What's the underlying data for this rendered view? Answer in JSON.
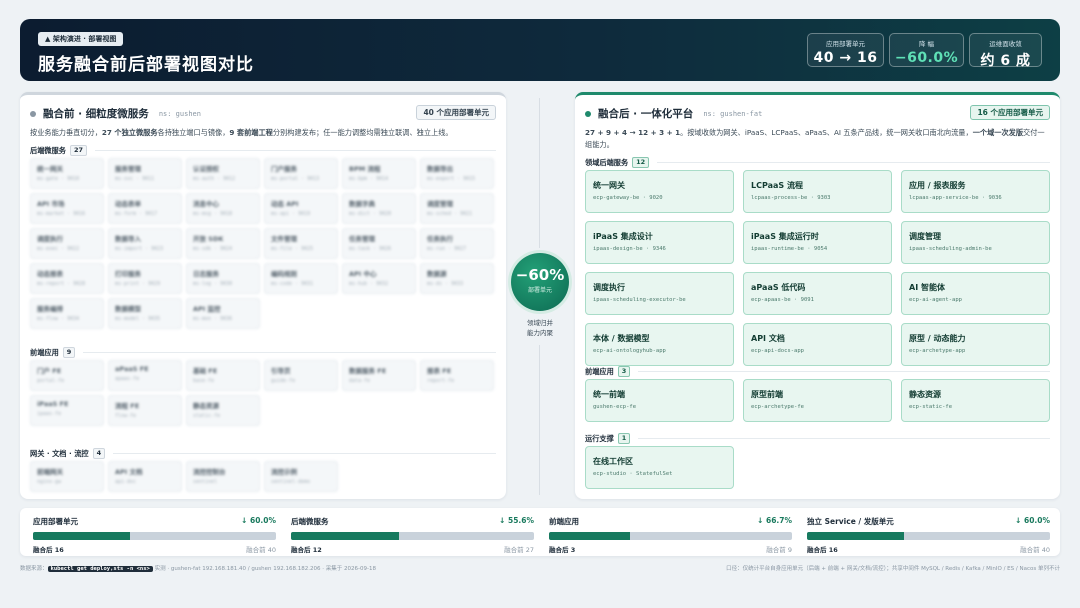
{
  "header": {
    "tag": "▲ 架构演进 · 部署视图",
    "title": "服务融合前后部署视图对比",
    "kpis": [
      {
        "label": "应用部署单元",
        "value": "40 → 16"
      },
      {
        "label": "降 幅",
        "value": "−60.0%"
      },
      {
        "label": "运维面收敛",
        "value": "约 6 成"
      }
    ]
  },
  "left": {
    "title": "融合前 · 细粒度微服务",
    "ns": "ns: gushen",
    "badge": "40 个应用部署单元",
    "desc": {
      "a": "按业务能力垂直切分，",
      "b": "27 个独立微服务",
      "c": "各持独立端口与镜像，",
      "d": "9 套前端工程",
      "e": "分别构建发布；任一能力调整均需独立联调、独立上线。"
    },
    "sections": [
      {
        "label": "后端微服务",
        "count": "27",
        "items": [
          {
            "n": "统一网关",
            "c": "ms-gate · 9010"
          },
          {
            "n": "服务管理",
            "c": "ms-svc · 9011"
          },
          {
            "n": "认证授权",
            "c": "ms-auth · 9012"
          },
          {
            "n": "门户服务",
            "c": "ms-portal · 9013"
          },
          {
            "n": "BPM 流程",
            "c": "ms-bpm · 9014"
          },
          {
            "n": "数据导出",
            "c": "ms-export · 9015"
          },
          {
            "n": "API 市场",
            "c": "ms-market · 9016"
          },
          {
            "n": "动态表单",
            "c": "ms-form · 9017"
          },
          {
            "n": "消息中心",
            "c": "ms-msg · 9018"
          },
          {
            "n": "动态 API",
            "c": "ms-api · 9019"
          },
          {
            "n": "数据字典",
            "c": "ms-dict · 9020"
          },
          {
            "n": "调度管理",
            "c": "ms-sched · 9021"
          },
          {
            "n": "调度执行",
            "c": "ms-exec · 9022"
          },
          {
            "n": "数据导入",
            "c": "ms-import · 9023"
          },
          {
            "n": "开放 SDK",
            "c": "ms-sdk · 9024"
          },
          {
            "n": "文件管理",
            "c": "ms-file · 9025"
          },
          {
            "n": "任务管理",
            "c": "ms-task · 9026"
          },
          {
            "n": "任务执行",
            "c": "ms-run · 9027"
          },
          {
            "n": "动态报表",
            "c": "ms-report · 9028"
          },
          {
            "n": "打印服务",
            "c": "ms-print · 9029"
          },
          {
            "n": "日志服务",
            "c": "ms-log · 9030"
          },
          {
            "n": "编码规则",
            "c": "ms-code · 9031"
          },
          {
            "n": "API 中心",
            "c": "ms-hub · 9032"
          },
          {
            "n": "数据源",
            "c": "ms-ds · 9033"
          },
          {
            "n": "服务编排",
            "c": "ms-flow · 9034"
          },
          {
            "n": "数据模型",
            "c": "ms-model · 9035"
          },
          {
            "n": "API 监控",
            "c": "ms-mon · 9036"
          }
        ]
      },
      {
        "label": "前端应用",
        "count": "9",
        "items": [
          {
            "n": "门户 FE",
            "c": "portal-fe"
          },
          {
            "n": "aPaaS FE",
            "c": "apaas-fe"
          },
          {
            "n": "基础 FE",
            "c": "base-fe"
          },
          {
            "n": "引导页",
            "c": "guide-fe"
          },
          {
            "n": "数据服务 FE",
            "c": "data-fe"
          },
          {
            "n": "报表 FE",
            "c": "report-fe"
          },
          {
            "n": "iPaaS FE",
            "c": "ipaas-fe"
          },
          {
            "n": "流程 FE",
            "c": "flow-fe"
          },
          {
            "n": "静态资源",
            "c": "static-fe"
          }
        ]
      },
      {
        "label": "网关 · 文档 · 流控",
        "count": "4",
        "items": [
          {
            "n": "前端网关",
            "c": "nginx-gw"
          },
          {
            "n": "API 文档",
            "c": "api-doc"
          },
          {
            "n": "流控控制台",
            "c": "sentinel"
          },
          {
            "n": "流控示例",
            "c": "sentinel-demo"
          }
        ]
      }
    ]
  },
  "right": {
    "title": "融合后 · 一体化平台",
    "ns": "ns: gushen-fat",
    "badge": "16 个应用部署单元",
    "desc": {
      "a": "27 + 9 + 4 → 12 + 3 + 1",
      "b": "。按域收敛为网关、iPaaS、LCPaaS、aPaaS、AI 五条产品线，统一网关收口南北向流量，",
      "c": "一个域一次发版",
      "d": "交付一组能力。"
    },
    "sections": [
      {
        "label": "领域后端服务",
        "count": "12",
        "items": [
          {
            "n": "统一网关",
            "c": "ecp-gateway-be · 9020"
          },
          {
            "n": "LCPaaS 流程",
            "c": "lcpaas-process-be · 9303"
          },
          {
            "n": "应用 / 报表服务",
            "c": "lcpaas-app-service-be · 9036"
          },
          {
            "n": "iPaaS 集成设计",
            "c": "ipaas-design-be · 9346"
          },
          {
            "n": "iPaaS 集成运行时",
            "c": "ipaas-runtime-be · 9054"
          },
          {
            "n": "调度管理",
            "c": "ipaas-scheduling-admin-be"
          },
          {
            "n": "调度执行",
            "c": "ipaas-scheduling-executor-be"
          },
          {
            "n": "aPaaS 低代码",
            "c": "ecp-apaas-be · 9091"
          },
          {
            "n": "AI 智能体",
            "c": "ecp-ai-agent-app"
          },
          {
            "n": "本体 / 数据模型",
            "c": "ecp-ai-ontologyhub-app"
          },
          {
            "n": "API 文档",
            "c": "ecp-api-docs-app"
          },
          {
            "n": "原型 / 动态能力",
            "c": "ecp-archetype-app"
          }
        ]
      },
      {
        "label": "前端应用",
        "count": "3",
        "items": [
          {
            "n": "统一前端",
            "c": "gushen-ecp-fe"
          },
          {
            "n": "原型前端",
            "c": "ecp-archetype-fe"
          },
          {
            "n": "静态资源",
            "c": "ecp-static-fe"
          }
        ]
      },
      {
        "label": "运行支撑",
        "count": "1",
        "items": [
          {
            "n": "在线工作区",
            "c": "ecp-studio · StatefulSet"
          }
        ]
      }
    ]
  },
  "middle": {
    "value": "−60%",
    "sub": "部署单元",
    "note1": "领域归并",
    "note2": "能力内聚"
  },
  "stats": [
    {
      "title": "应用部署单元",
      "pct": "↓ 60.0%",
      "after": "融合后 16",
      "before": "融合前 40",
      "ratio": 0.4
    },
    {
      "title": "后端微服务",
      "pct": "↓ 55.6%",
      "after": "融合后 12",
      "before": "融合前 27",
      "ratio": 0.444
    },
    {
      "title": "前端应用",
      "pct": "↓ 66.7%",
      "after": "融合后 3",
      "before": "融合前 9",
      "ratio": 0.333
    },
    {
      "title": "独立 Service / 发版单元",
      "pct": "↓ 60.0%",
      "after": "融合后 16",
      "before": "融合前 40",
      "ratio": 0.4
    }
  ],
  "footer": {
    "prefix": "数据来源：",
    "cmd": "kubectl get deploy,sts -n <ns>",
    "rest": " 实测 · gushen-fat 192.168.181.40 / gushen 192.168.182.206 · 采集于 2026-09-18",
    "right": "口径：仅统计平台自身应用单元（后端 + 前端 + 网关/文档/流控）；共享中间件 MySQL / Redis / Kafka / MinIO / ES / Nacos 单列不计"
  }
}
